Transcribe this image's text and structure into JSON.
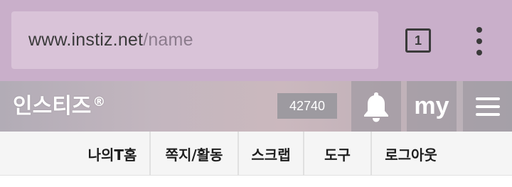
{
  "browser": {
    "url_domain": "www.instiz.net",
    "url_path": "/name",
    "tab_count": "1",
    "icons": {
      "tabs": "tab-count-icon",
      "menu": "more-vert-icon"
    }
  },
  "header": {
    "logo_text": "인스티즈",
    "logo_mark": "®",
    "counter": "42740",
    "my_label": "my",
    "icons": {
      "notifications": "bell-icon",
      "menu": "hamburger-icon"
    }
  },
  "nav": {
    "items": [
      {
        "label": "나의T홈"
      },
      {
        "label": "쪽지/활동"
      },
      {
        "label": "스크랩"
      },
      {
        "label": "도구"
      },
      {
        "label": "로그아웃"
      }
    ]
  },
  "colors": {
    "chrome_bg": "#c9afca",
    "url_bar_bg": "#d9c3d8",
    "nav_bg": "#f5f5f5"
  }
}
